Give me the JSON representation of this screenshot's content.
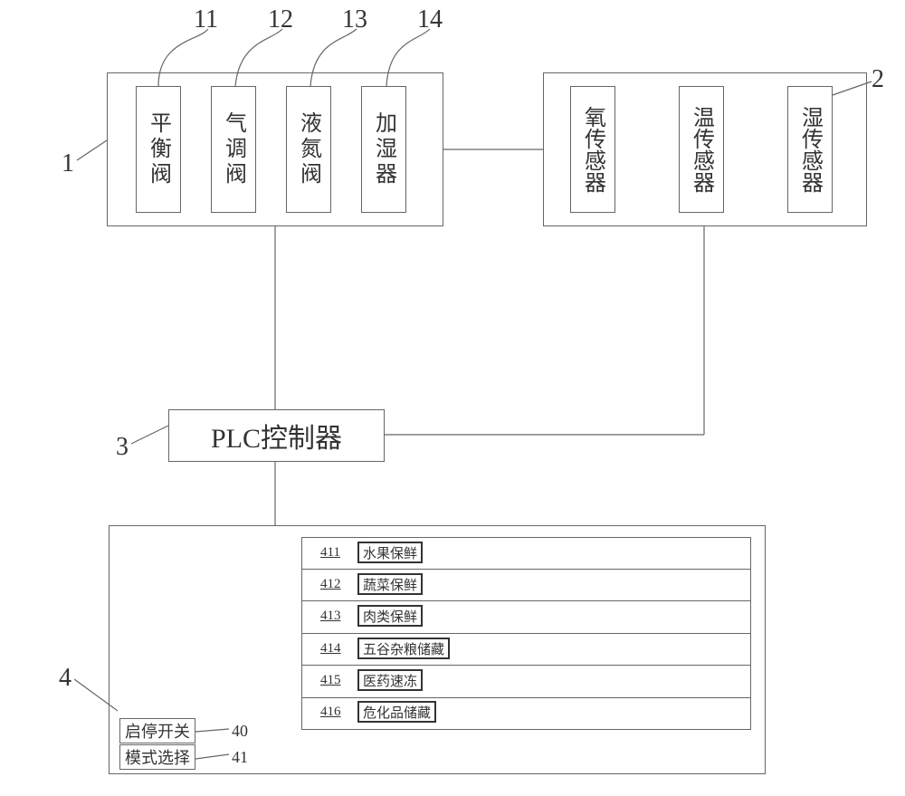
{
  "labels": {
    "n1": "1",
    "n2": "2",
    "n3": "3",
    "n4": "4",
    "n11": "11",
    "n12": "12",
    "n13": "13",
    "n14": "14",
    "n40": "40",
    "n41": "41",
    "n411": "411",
    "n412": "412",
    "n413": "413",
    "n414": "414",
    "n415": "415",
    "n416": "416"
  },
  "block1": {
    "item11": "平衡阀",
    "item12": "气调阀",
    "item13": "液氮阀",
    "item14": "加湿器"
  },
  "block2": {
    "sensor_o2": "氧传感器",
    "sensor_temp": "温传感器",
    "sensor_humid": "湿传感器"
  },
  "block3": {
    "title": "PLC控制器"
  },
  "block4": {
    "btn40": "启停开关",
    "btn41": "模式选择",
    "modes": {
      "m411": "水果保鲜",
      "m412": "蔬菜保鲜",
      "m413": "肉类保鲜",
      "m414": "五谷杂粮储藏",
      "m415": "医药速冻",
      "m416": "危化品储藏"
    }
  }
}
